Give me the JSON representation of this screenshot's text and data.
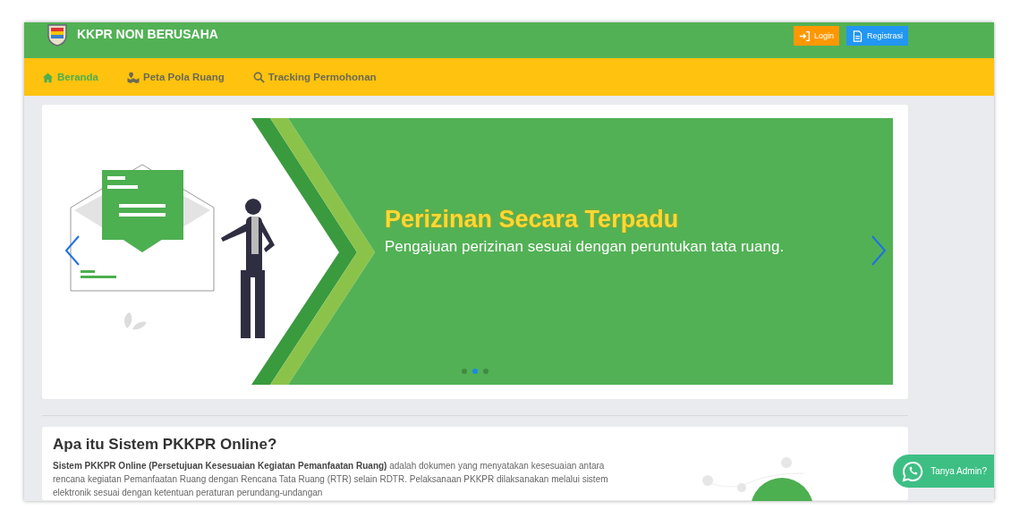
{
  "header": {
    "title": "KKPR NON BERUSAHA",
    "buttons": [
      {
        "label": "Login",
        "kind": "login"
      },
      {
        "label": "Registrasi",
        "kind": "register"
      }
    ]
  },
  "nav": [
    {
      "label": "Beranda",
      "kind": "home",
      "selected": true
    },
    {
      "label": "Peta Pola Ruang",
      "kind": "map",
      "selected": false
    },
    {
      "label": "Tracking Permohonan",
      "kind": "search",
      "selected": false
    }
  ],
  "carousel": {
    "title": "Perizinan Secara Terpadu",
    "subtitle": "Pengajuan perizinan sesuai dengan peruntukan tata ruang.",
    "dots": [
      {
        "selected": false
      },
      {
        "selected": true
      },
      {
        "selected": false
      }
    ]
  },
  "about": {
    "heading": "Apa itu Sistem PKKPR Online?",
    "paragraph": "**Sistem PKKPR Online (Persetujuan Kesesuaian Kegiatan Pemanfaatan Ruang)** adalah dokumen yang menyatakan kesesuaian antara rencana kegiatan Pemanfaatan Ruang dengan Rencana Tata Ruang (RTR) selain RDTR. Pelaksanaan PKKPR dilaksanakan melalui sistem elektronik sesuai dengan ketentuan peraturan perundang-undangan"
  },
  "chat_button": {
    "label": "Tanya Admin?"
  }
}
